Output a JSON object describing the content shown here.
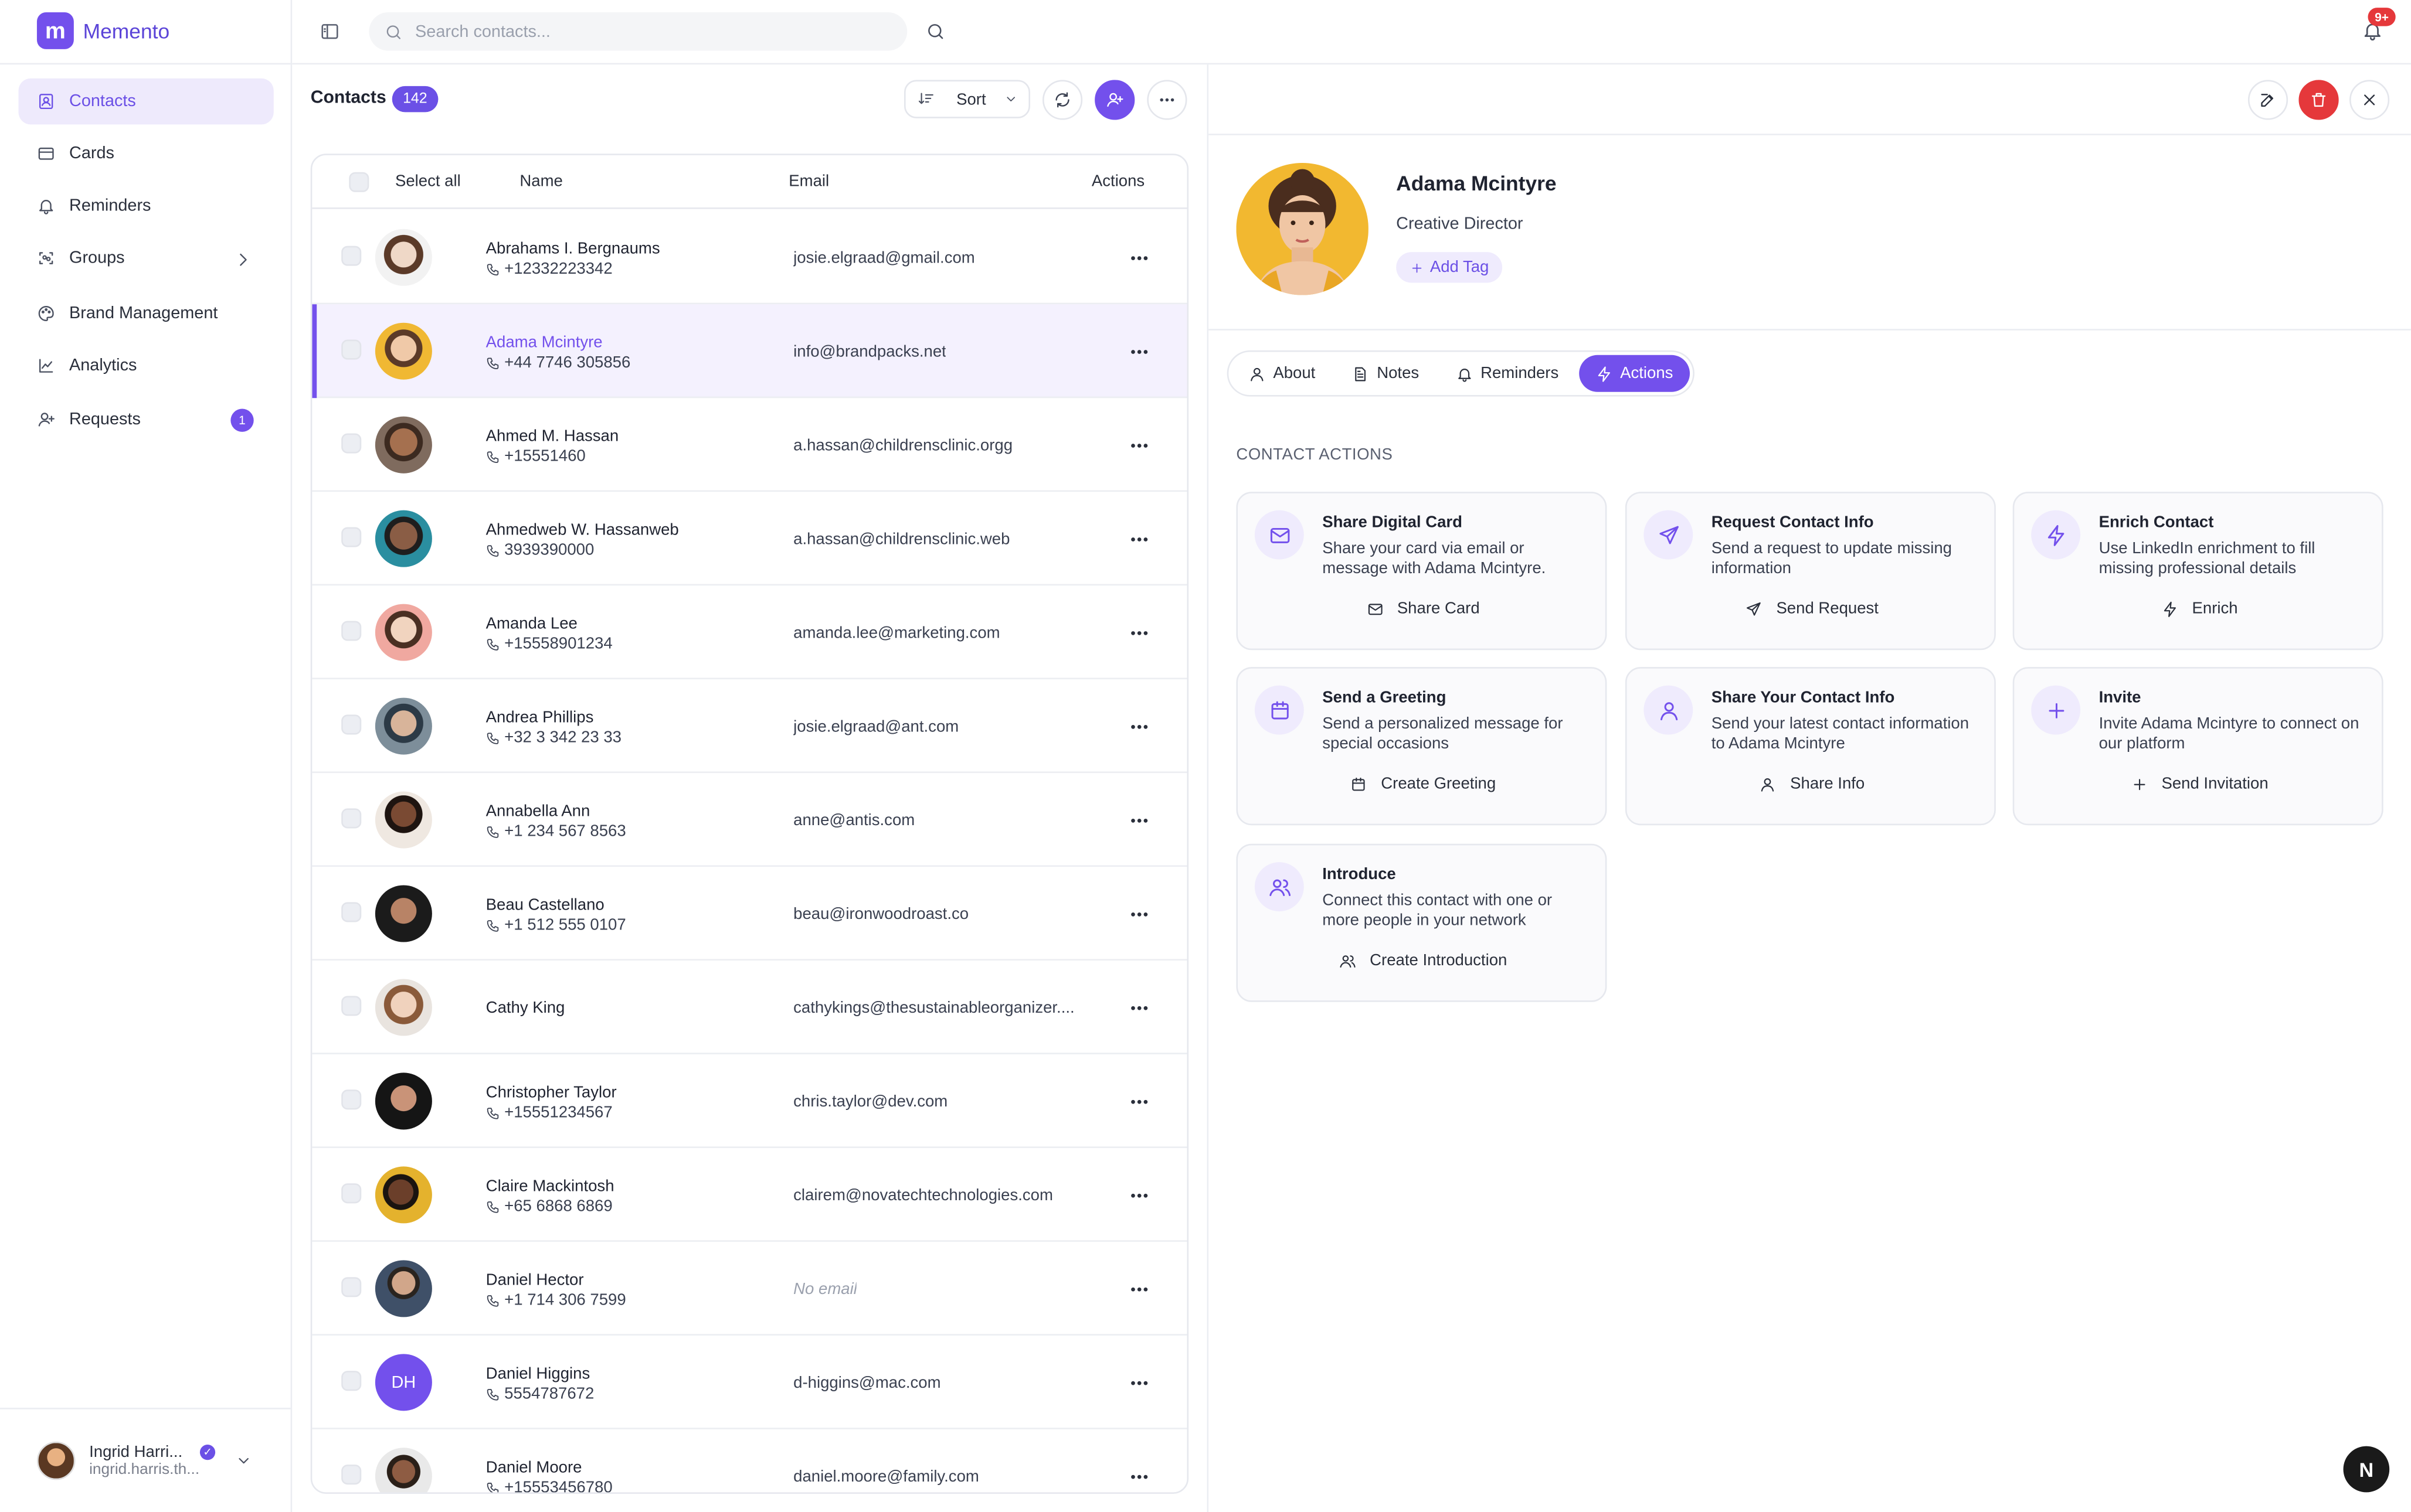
{
  "app": {
    "name": "Memento",
    "logo_letter": "m",
    "accent": "#7350ec"
  },
  "sidebar": {
    "items": [
      {
        "label": "Contacts",
        "icon": "contacts-icon",
        "active": true
      },
      {
        "label": "Cards",
        "icon": "card-icon"
      },
      {
        "label": "Reminders",
        "icon": "bell-icon"
      },
      {
        "label": "Groups",
        "icon": "groups-icon"
      },
      {
        "label": "Brand Management",
        "icon": "palette-icon"
      },
      {
        "label": "Analytics",
        "icon": "chart-icon"
      },
      {
        "label": "Requests",
        "icon": "user-plus-icon",
        "badge": "1"
      }
    ],
    "user": {
      "name": "Ingrid Harri...",
      "email": "ingrid.harris.th...",
      "verified_mark": "✓"
    }
  },
  "topbar": {
    "search_placeholder": "Search contacts...",
    "notification_badge": "9+"
  },
  "contacts": {
    "title": "Contacts",
    "count": "142",
    "sort_label": "Sort",
    "headers": {
      "select_all": "Select all",
      "name": "Name",
      "email": "Email",
      "actions": "Actions"
    },
    "rows": [
      {
        "name": "Abrahams I. Bergnaums",
        "phone": "+12332223342",
        "email": "josie.elgraad@gmail.com"
      },
      {
        "name": "Adama Mcintyre",
        "phone": "+44 7746 305856",
        "email": "info@brandpacks.net",
        "selected": true
      },
      {
        "name": "Ahmed M. Hassan",
        "phone": "+15551460",
        "email": "a.hassan@childrensclinic.orgg"
      },
      {
        "name": "Ahmedweb W. Hassanweb",
        "phone": "3939390000",
        "email": "a.hassan@childrensclinic.web"
      },
      {
        "name": "Amanda Lee",
        "phone": "+15558901234",
        "email": "amanda.lee@marketing.com"
      },
      {
        "name": "Andrea Phillips",
        "phone": "+32 3 342 23 33",
        "email": "josie.elgraad@ant.com"
      },
      {
        "name": "Annabella Ann",
        "phone": "+1 234 567 8563",
        "email": "anne@antis.com"
      },
      {
        "name": "Beau Castellano",
        "phone": "+1 512 555 0107",
        "email": "beau@ironwoodroast.co"
      },
      {
        "name": "Cathy King",
        "phone": "",
        "email": "cathykings@thesustainableorganizer...."
      },
      {
        "name": "Christopher Taylor",
        "phone": "+15551234567",
        "email": "chris.taylor@dev.com"
      },
      {
        "name": "Claire Mackintosh",
        "phone": "+65 6868 6869",
        "email": "clairem@novatechtechnologies.com"
      },
      {
        "name": "Daniel Hector",
        "phone": "+1 714 306 7599",
        "email": "No email",
        "no_email": true
      },
      {
        "name": "Daniel Higgins",
        "phone": "5554787672",
        "email": "d-higgins@mac.com",
        "initials": "DH"
      },
      {
        "name": "Daniel Moore",
        "phone": "+15553456780",
        "email": "daniel.moore@family.com"
      }
    ]
  },
  "detail": {
    "name": "Adama Mcintyre",
    "role": "Creative Director",
    "add_tag": "Add Tag",
    "tabs": [
      {
        "label": "About",
        "icon": "user-icon"
      },
      {
        "label": "Notes",
        "icon": "note-icon"
      },
      {
        "label": "Reminders",
        "icon": "bell-icon"
      },
      {
        "label": "Actions",
        "icon": "bolt-icon",
        "active": true
      }
    ],
    "section_label": "CONTACT ACTIONS",
    "cards": [
      {
        "title": "Share Digital Card",
        "desc": "Share your card via email or message with Adama Mcintyre.",
        "action": "Share Card",
        "icon": "mail-icon"
      },
      {
        "title": "Request Contact Info",
        "desc": "Send a request to update missing information",
        "action": "Send Request",
        "icon": "send-icon"
      },
      {
        "title": "Enrich Contact",
        "desc": "Use LinkedIn enrichment to fill missing professional details",
        "action": "Enrich",
        "icon": "bolt-icon"
      },
      {
        "title": "Send a Greeting",
        "desc": "Send a personalized message for special occasions",
        "action": "Create Greeting",
        "icon": "calendar-icon"
      },
      {
        "title": "Share Your Contact Info",
        "desc": "Send your latest contact information to Adama Mcintyre",
        "action": "Share Info",
        "icon": "user-icon"
      },
      {
        "title": "Invite",
        "desc": "Invite Adama Mcintyre to connect on our platform",
        "action": "Send Invitation",
        "icon": "plus-icon"
      },
      {
        "title": "Introduce",
        "desc": "Connect this contact with one or more people in your network",
        "action": "Create Introduction",
        "icon": "users-icon"
      }
    ]
  },
  "footer_badge": "N"
}
